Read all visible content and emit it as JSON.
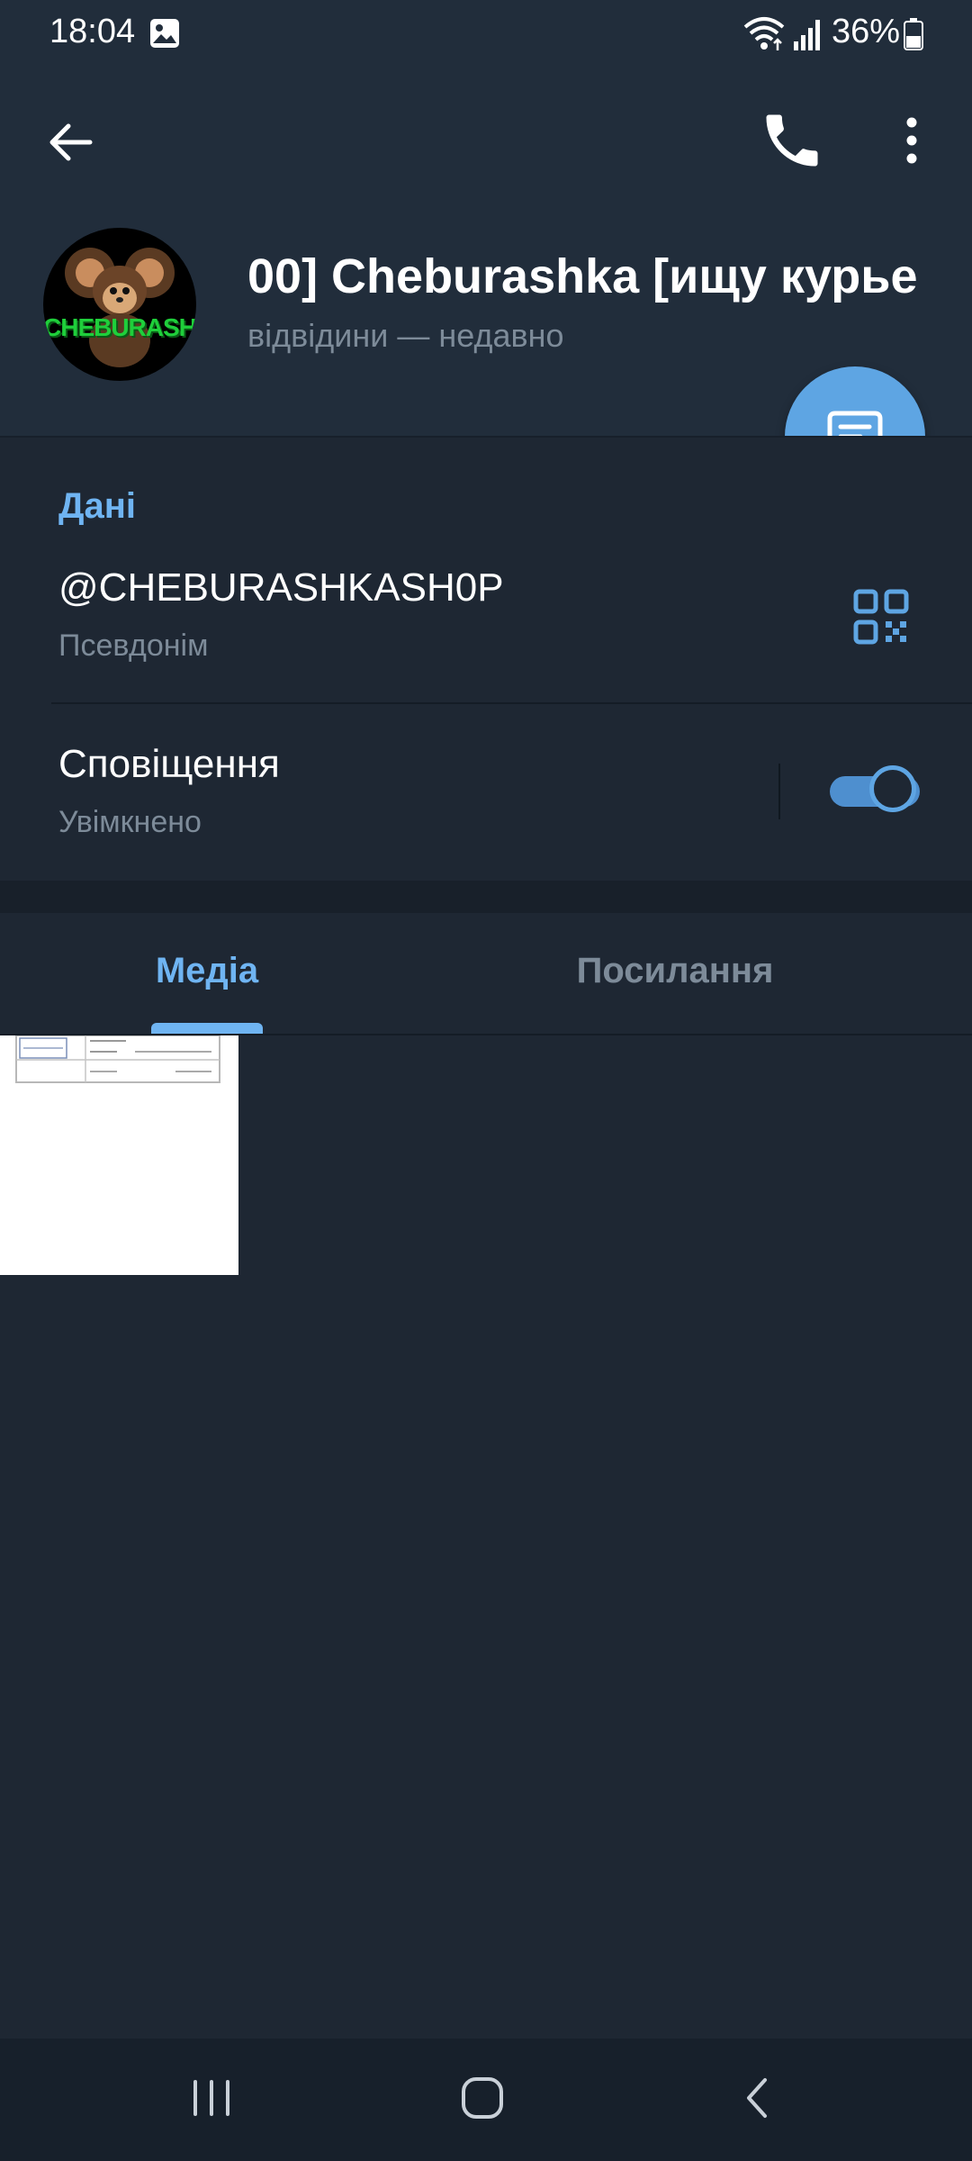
{
  "status_bar": {
    "time": "18:04",
    "battery": "36%",
    "icons": [
      "gallery-icon",
      "wifi-icon",
      "signal-icon",
      "battery-icon"
    ]
  },
  "header": {
    "icons": [
      "back-arrow-icon",
      "phone-icon",
      "more-vertical-icon"
    ],
    "avatar_text": "CHEBURASHKA",
    "name": "00]    Cheburashka [ищу курье",
    "status": "відвідини — недавно",
    "fab_icon": "message-icon"
  },
  "info": {
    "section_title": "Дані",
    "username": "@CHEBURASHKASH0P",
    "username_caption": "Псевдонім",
    "qr_icon": "qr-code-icon",
    "notifications_title": "Сповіщення",
    "notifications_caption": "Увімкнено",
    "notifications_enabled": true
  },
  "tabs": {
    "items": [
      {
        "label": "Медіа",
        "active": true
      },
      {
        "label": "Посилання",
        "active": false
      }
    ]
  },
  "media": {
    "items": [
      {
        "type": "image"
      }
    ]
  },
  "nav_bar": {
    "icons": [
      "recents-icon",
      "home-icon",
      "back-icon"
    ]
  },
  "colors": {
    "background": "#1e2733",
    "header_background": "#212d3b",
    "accent": "#6fb4f2",
    "fab": "#5ea5e3",
    "secondary_text": "#7d8b99"
  }
}
